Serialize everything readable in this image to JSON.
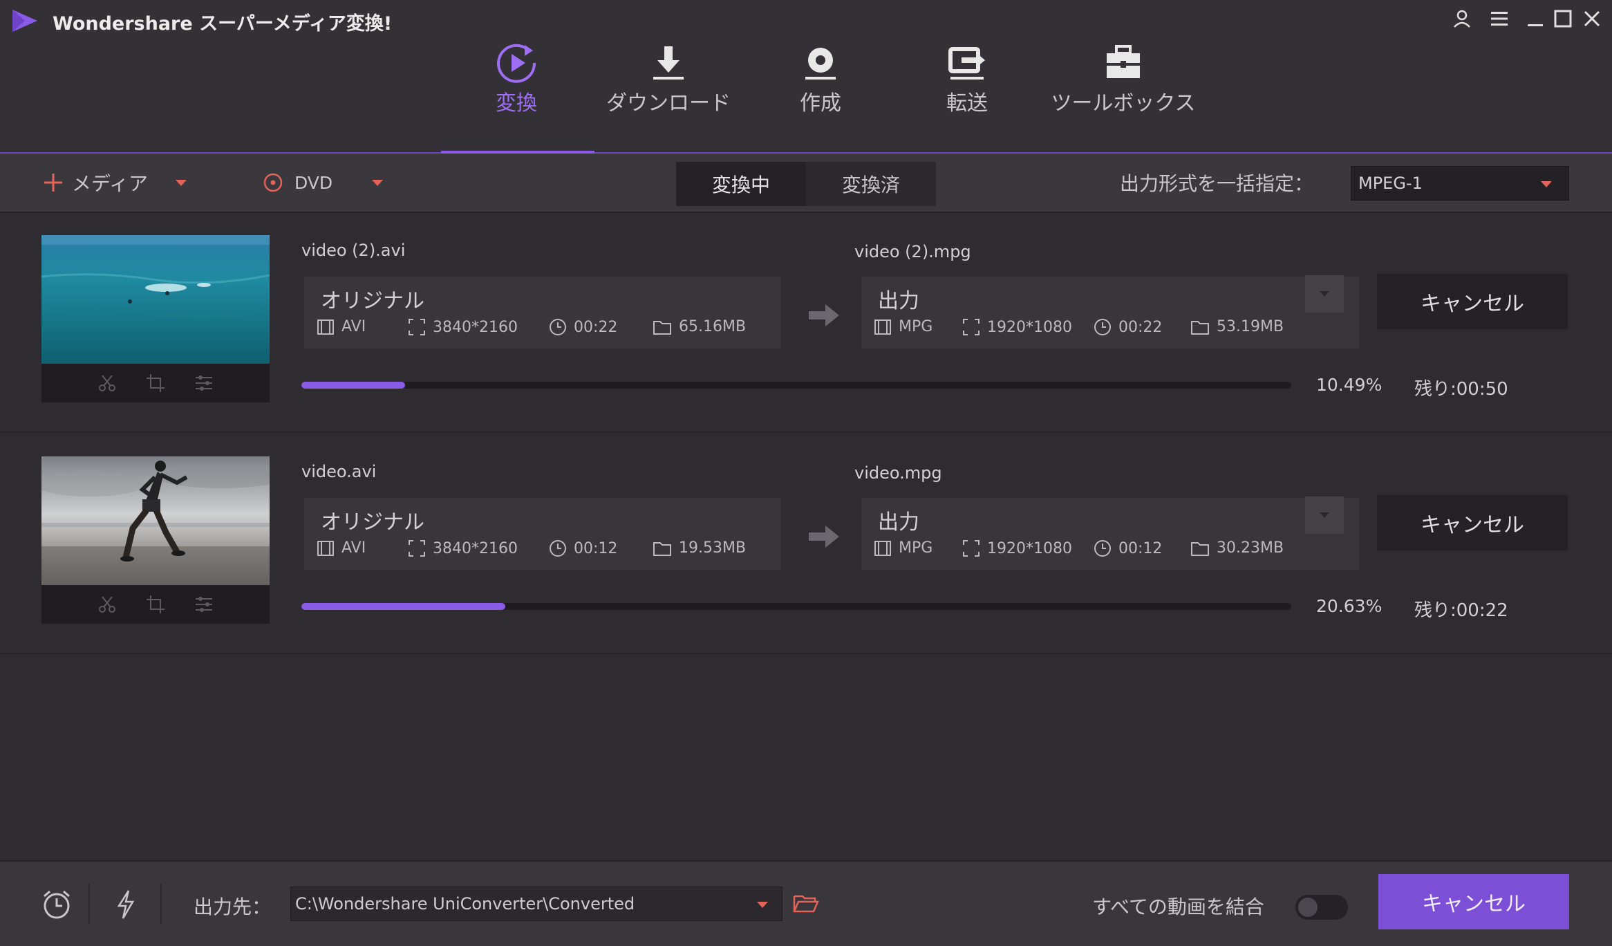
{
  "app": {
    "title": "Wondershare スーパーメディア変換!"
  },
  "nav": {
    "tabs": [
      {
        "label": "変換",
        "icon": "convert-icon",
        "active": true
      },
      {
        "label": "ダウンロード",
        "icon": "download-icon"
      },
      {
        "label": "作成",
        "icon": "burn-icon"
      },
      {
        "label": "転送",
        "icon": "transfer-icon"
      },
      {
        "label": "ツールボックス",
        "icon": "toolbox-icon"
      }
    ]
  },
  "toolbar": {
    "add_media": "メディア",
    "dvd": "DVD",
    "segment": {
      "converting": "変換中",
      "converted": "変換済"
    },
    "format_label": "出力形式を一括指定：",
    "format_value": "MPEG-1"
  },
  "items": [
    {
      "source_name": "video (2).avi",
      "output_name": "video (2).mpg",
      "source": {
        "header": "オリジナル",
        "format": "AVI",
        "resolution": "3840*2160",
        "duration": "00:22",
        "size": "65.16MB"
      },
      "output": {
        "header": "出力",
        "format": "MPG",
        "resolution": "1920*1080",
        "duration": "00:22",
        "size": "53.19MB"
      },
      "cancel": "キャンセル",
      "progress_percent": 10.49,
      "percent_label": "10.49%",
      "remaining": "残り:00:50"
    },
    {
      "source_name": "video.avi",
      "output_name": "video.mpg",
      "source": {
        "header": "オリジナル",
        "format": "AVI",
        "resolution": "3840*2160",
        "duration": "00:12",
        "size": "19.53MB"
      },
      "output": {
        "header": "出力",
        "format": "MPG",
        "resolution": "1920*1080",
        "duration": "00:12",
        "size": "30.23MB"
      },
      "cancel": "キャンセル",
      "progress_percent": 20.63,
      "percent_label": "20.63%",
      "remaining": "残り:00:22"
    }
  ],
  "bottom": {
    "output_label": "出力先：",
    "output_path": "C:\\Wondershare UniConverter\\Converted",
    "merge_label": "すべての動画を結合",
    "merge_enabled": false,
    "cancel_all": "キャンセル"
  },
  "colors": {
    "accent": "#8a5be6",
    "dropdown_caret": "#e4635a",
    "background": "#2e2c31"
  }
}
